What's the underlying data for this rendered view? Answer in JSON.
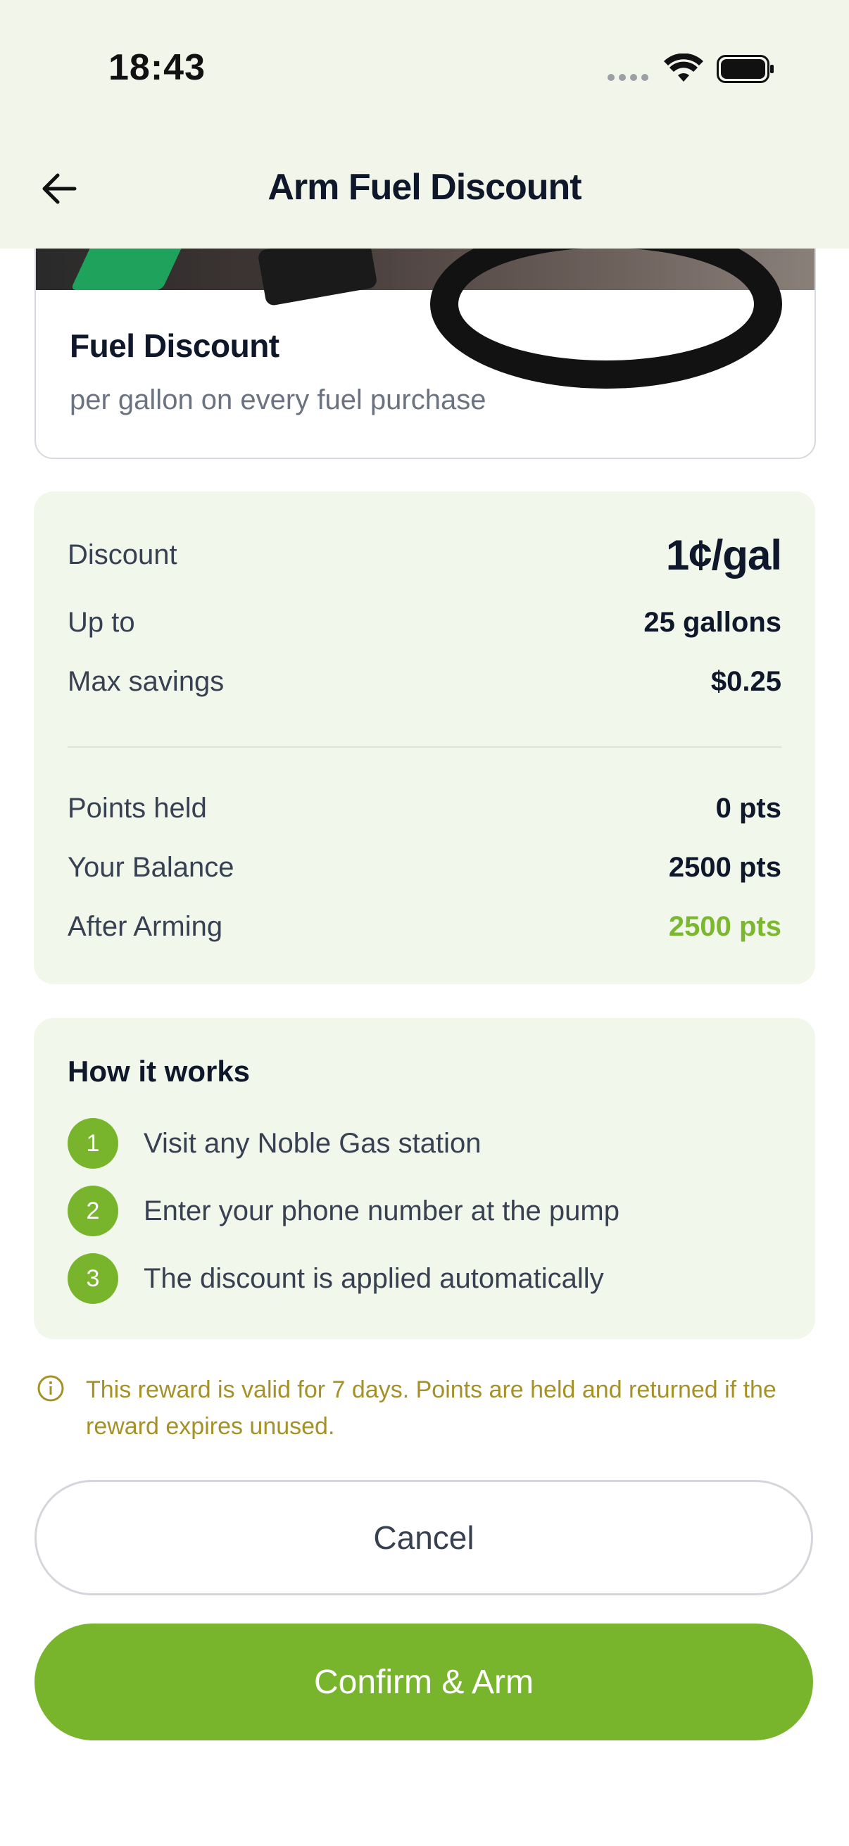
{
  "status_bar": {
    "time": "18:43"
  },
  "header": {
    "title": "Arm Fuel Discount",
    "back_icon": "arrow-left-icon"
  },
  "reward": {
    "title": "Fuel Discount",
    "subtitle": "per gallon on every fuel purchase"
  },
  "details": {
    "discount_label": "Discount",
    "discount_value": "1¢/gal",
    "up_to_label": "Up to",
    "up_to_value": "25 gallons",
    "max_savings_label": "Max savings",
    "max_savings_value": "$0.25",
    "points_held_label": "Points held",
    "points_held_value": "0 pts",
    "balance_label": "Your Balance",
    "balance_value": "2500 pts",
    "after_arming_label": "After Arming",
    "after_arming_value": "2500 pts"
  },
  "how_it_works": {
    "title": "How it works",
    "steps": [
      {
        "num": "1",
        "text": "Visit any Noble Gas station"
      },
      {
        "num": "2",
        "text": "Enter your phone number at the pump"
      },
      {
        "num": "3",
        "text": "The discount is applied automatically"
      }
    ]
  },
  "info": {
    "text": "This reward is valid for 7 days. Points are held and returned if the reward expires unused."
  },
  "actions": {
    "cancel_label": "Cancel",
    "confirm_label": "Confirm & Arm"
  },
  "colors": {
    "accent": "#78b52d",
    "header_bg": "#f2f6ea",
    "panel_bg": "#f2f7ec",
    "info_text": "#a49228"
  }
}
